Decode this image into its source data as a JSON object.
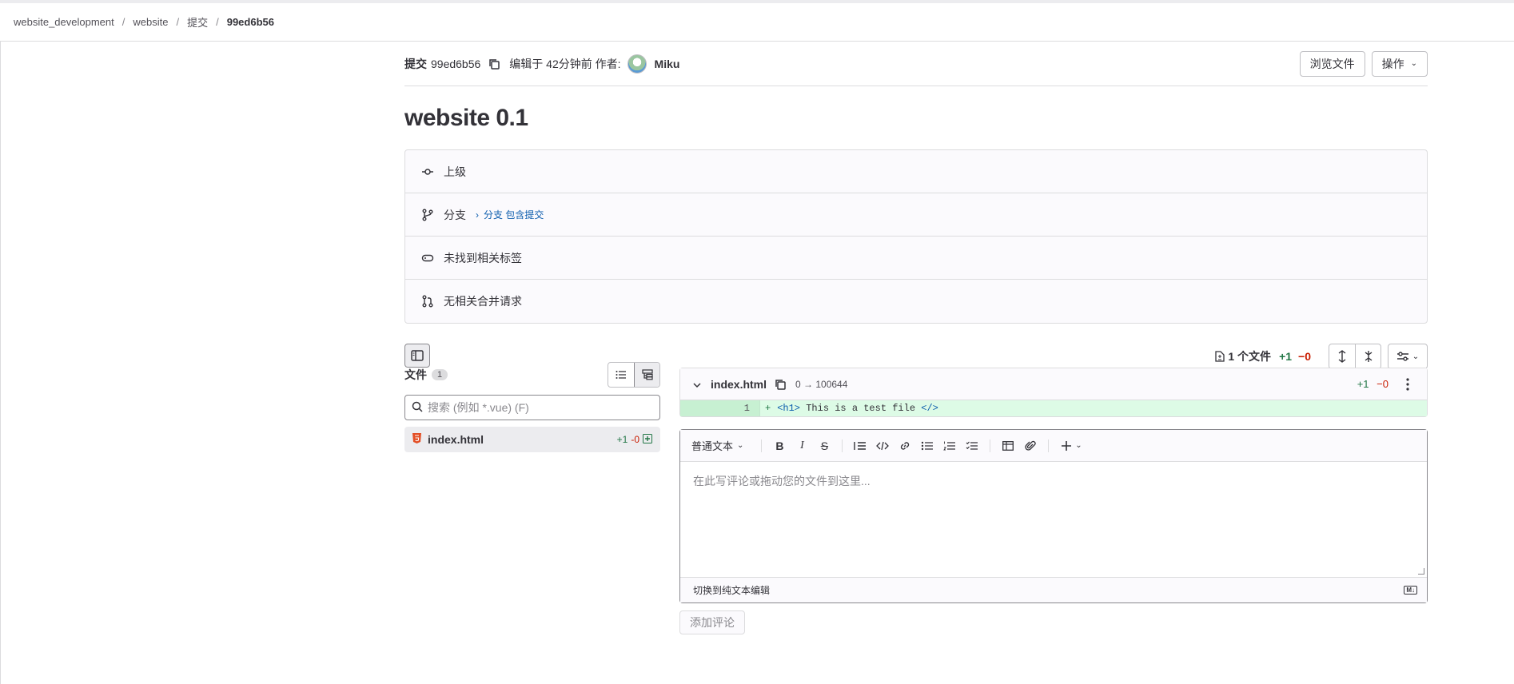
{
  "breadcrumb": [
    "website_development",
    "website",
    "提交",
    "99ed6b56"
  ],
  "commit": {
    "label": "提交",
    "sha": "99ed6b56",
    "edited_text": "编辑于 42分钟前 作者:",
    "author": "Miku",
    "browse_files": "浏览文件",
    "actions": "操作",
    "title": "website 0.1"
  },
  "info": {
    "parent": "上级",
    "branch": "分支",
    "branch_link": "分支 包含提交",
    "tags": "未找到相关标签",
    "merge_requests": "无相关合并请求"
  },
  "diff_stats": {
    "files": "1 个文件",
    "added": "+1",
    "removed": "−0"
  },
  "files_panel": {
    "label": "文件",
    "count": "1",
    "search_placeholder": "搜索 (例如 *.vue) (F)",
    "files": [
      {
        "name": "index.html",
        "added": "+1",
        "removed": "-0"
      }
    ]
  },
  "diff_file": {
    "name": "index.html",
    "mode": "0 → 100644",
    "added": "+1",
    "removed": "−0",
    "lines": [
      {
        "num": "1",
        "prefix": "+",
        "open_tag": "<h1>",
        "text": " This is a test file ",
        "close_tag": "</>"
      }
    ]
  },
  "editor": {
    "text_style": "普通文本",
    "placeholder": "在此写评论或拖动您的文件到这里...",
    "switch_label": "切换到纯文本编辑",
    "md_badge": "M↓",
    "add_comment": "添加评论"
  }
}
